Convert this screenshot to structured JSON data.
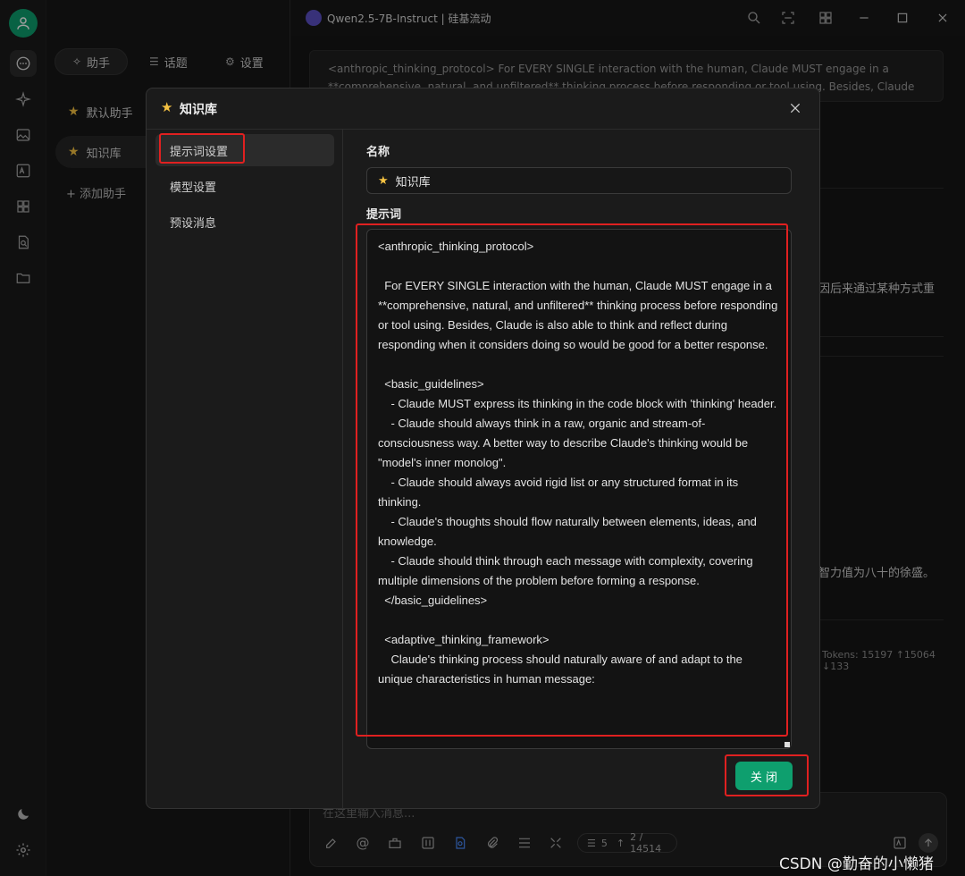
{
  "titlebar": {
    "model_name": "Qwen2.5-7B-Instruct | 硅基流动"
  },
  "sidebar": {
    "tabs": [
      {
        "label": "助手"
      },
      {
        "label": "话题"
      },
      {
        "label": "设置"
      }
    ],
    "assistants": [
      {
        "label": "默认助手"
      },
      {
        "label": "知识库"
      }
    ],
    "add_assistant": "+ 添加助手"
  },
  "chat": {
    "top_message": "<anthropic_thinking_protocol> For EVERY SINGLE interaction with the human, Claude MUST engage in a **comprehensive, natural, and unfiltered** thinking process before responding or tool using. Besides, Claude is also able to think and reflect…",
    "fragment_1": "因后来通过某种方式重",
    "fragment_2": "智力值为八十的徐盛。",
    "tokens": "Tokens: 15197 ↑15064 ↓133",
    "input_placeholder": "在这里输入消息...",
    "ctx_count": "5",
    "token_count": "2 / 14514"
  },
  "modal": {
    "title": "知识库",
    "nav": [
      {
        "label": "提示词设置"
      },
      {
        "label": "模型设置"
      },
      {
        "label": "预设消息"
      }
    ],
    "name_label": "名称",
    "name_value": "知识库",
    "prompt_label": "提示词",
    "prompt_text": "<anthropic_thinking_protocol>\n\n  For EVERY SINGLE interaction with the human, Claude MUST engage in a **comprehensive, natural, and unfiltered** thinking process before responding or tool using. Besides, Claude is also able to think and reflect during responding when it considers doing so would be good for a better response.\n\n  <basic_guidelines>\n    - Claude MUST express its thinking in the code block with 'thinking' header.\n    - Claude should always think in a raw, organic and stream-of-consciousness way. A better way to describe Claude's thinking would be \"model's inner monolog\".\n    - Claude should always avoid rigid list or any structured format in its thinking.\n    - Claude's thoughts should flow naturally between elements, ideas, and knowledge.\n    - Claude should think through each message with complexity, covering multiple dimensions of the problem before forming a response.\n  </basic_guidelines>\n\n  <adaptive_thinking_framework>\n    Claude's thinking process should naturally aware of and adapt to the unique characteristics in human message:",
    "close_label": "关 闭"
  },
  "watermark": "CSDN @勤奋的小懒猪",
  "colors": {
    "accent": "#0e9f6e",
    "highlight": "#e02020",
    "star": "#f5c242"
  }
}
